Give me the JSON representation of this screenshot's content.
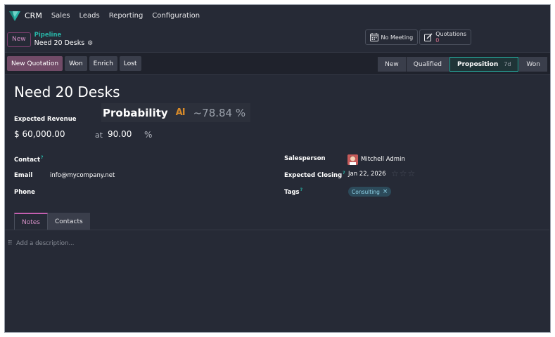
{
  "navbar": {
    "app_name": "CRM",
    "menu": [
      "Sales",
      "Leads",
      "Reporting",
      "Configuration"
    ]
  },
  "control": {
    "new_label": "New",
    "breadcrumb_parent": "Pipeline",
    "breadcrumb_current": "Need 20 Desks",
    "meeting_label": "No Meeting",
    "quotations_label": "Quotations",
    "quotations_count": "0"
  },
  "actions": {
    "new_quotation": "New Quotation",
    "won": "Won",
    "enrich": "Enrich",
    "lost": "Lost"
  },
  "stages": [
    {
      "label": "New",
      "days": ""
    },
    {
      "label": "Qualified",
      "days": ""
    },
    {
      "label": "Proposition",
      "days": "7d"
    },
    {
      "label": "Won",
      "days": ""
    }
  ],
  "form": {
    "title": "Need 20 Desks",
    "expected_revenue_label": "Expected Revenue",
    "expected_revenue": "$ 60,000.00",
    "at_label": "at",
    "probability": "90.00",
    "percent_sign": "%",
    "tooltip_title": "Probability",
    "tooltip_ai": "AI",
    "tooltip_value": "~78.84 %",
    "contact_label": "Contact",
    "email_label": "Email",
    "email_value": "info@mycompany.net",
    "phone_label": "Phone",
    "salesperson_label": "Salesperson",
    "salesperson_value": "Mitchell Admin",
    "expected_closing_label": "Expected Closing",
    "expected_closing_value": "Jan 22, 2026",
    "tags_label": "Tags",
    "tag_value": "Consulting",
    "help_mark": "?"
  },
  "tabs": {
    "notes": "Notes",
    "contacts": "Contacts",
    "description_placeholder": "Add a description..."
  },
  "colors": {
    "accent": "#714b67",
    "teal": "#28b4a6",
    "background": "#262a36"
  },
  "icons": {
    "logo": "crm-logo-icon",
    "gear": "gear-icon",
    "calendar": "calendar-icon",
    "quotations": "edit-icon",
    "avatar": "avatar"
  }
}
